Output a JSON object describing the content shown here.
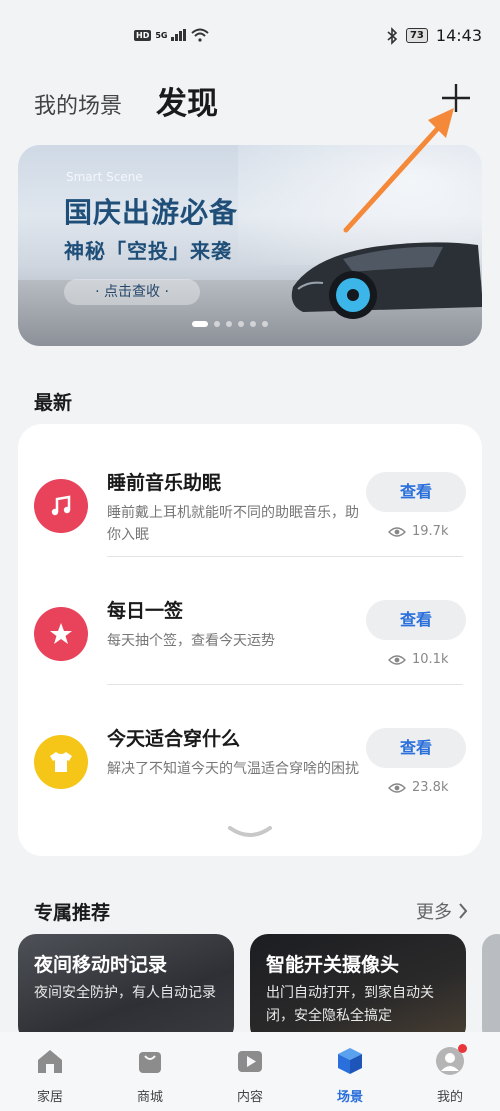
{
  "status_bar": {
    "hd": "HD",
    "network": "5G",
    "battery": "73",
    "time": "14:43"
  },
  "header": {
    "tab_scenes": "我的场景",
    "tab_discover": "发现"
  },
  "banner": {
    "small": "Smart Scene",
    "title": "国庆出游必备",
    "subtitle": "神秘「空投」来袭",
    "button": "· 点击查收 ·"
  },
  "latest": {
    "title": "最新",
    "items": [
      {
        "title": "睡前音乐助眠",
        "desc": "睡前戴上耳机就能听不同的助眠音乐，助你入眠",
        "button": "查看",
        "views": "19.7k",
        "icon": "music-note-icon",
        "color": "#e8435a"
      },
      {
        "title": "每日一签",
        "desc": "每天抽个签，查看今天运势",
        "button": "查看",
        "views": "10.1k",
        "icon": "star-icon",
        "color": "#e8435a"
      },
      {
        "title": "今天适合穿什么",
        "desc": "解决了不知道今天的气温适合穿啥的困扰",
        "button": "查看",
        "views": "23.8k",
        "icon": "tshirt-icon",
        "color": "#f5c518"
      }
    ]
  },
  "exclusive": {
    "title": "专属推荐",
    "more": "更多",
    "cards": [
      {
        "title": "夜间移动时记录",
        "desc": "夜间安全防护，有人自动记录"
      },
      {
        "title": "智能开关摄像头",
        "desc": "出门自动打开，到家自动关闭，安全隐私全搞定"
      }
    ]
  },
  "nav": [
    {
      "label": "家居",
      "icon": "home-icon"
    },
    {
      "label": "商城",
      "icon": "shopping-bag-icon"
    },
    {
      "label": "内容",
      "icon": "play-icon"
    },
    {
      "label": "场景",
      "icon": "cube-icon",
      "active": true
    },
    {
      "label": "我的",
      "icon": "avatar-icon"
    }
  ]
}
